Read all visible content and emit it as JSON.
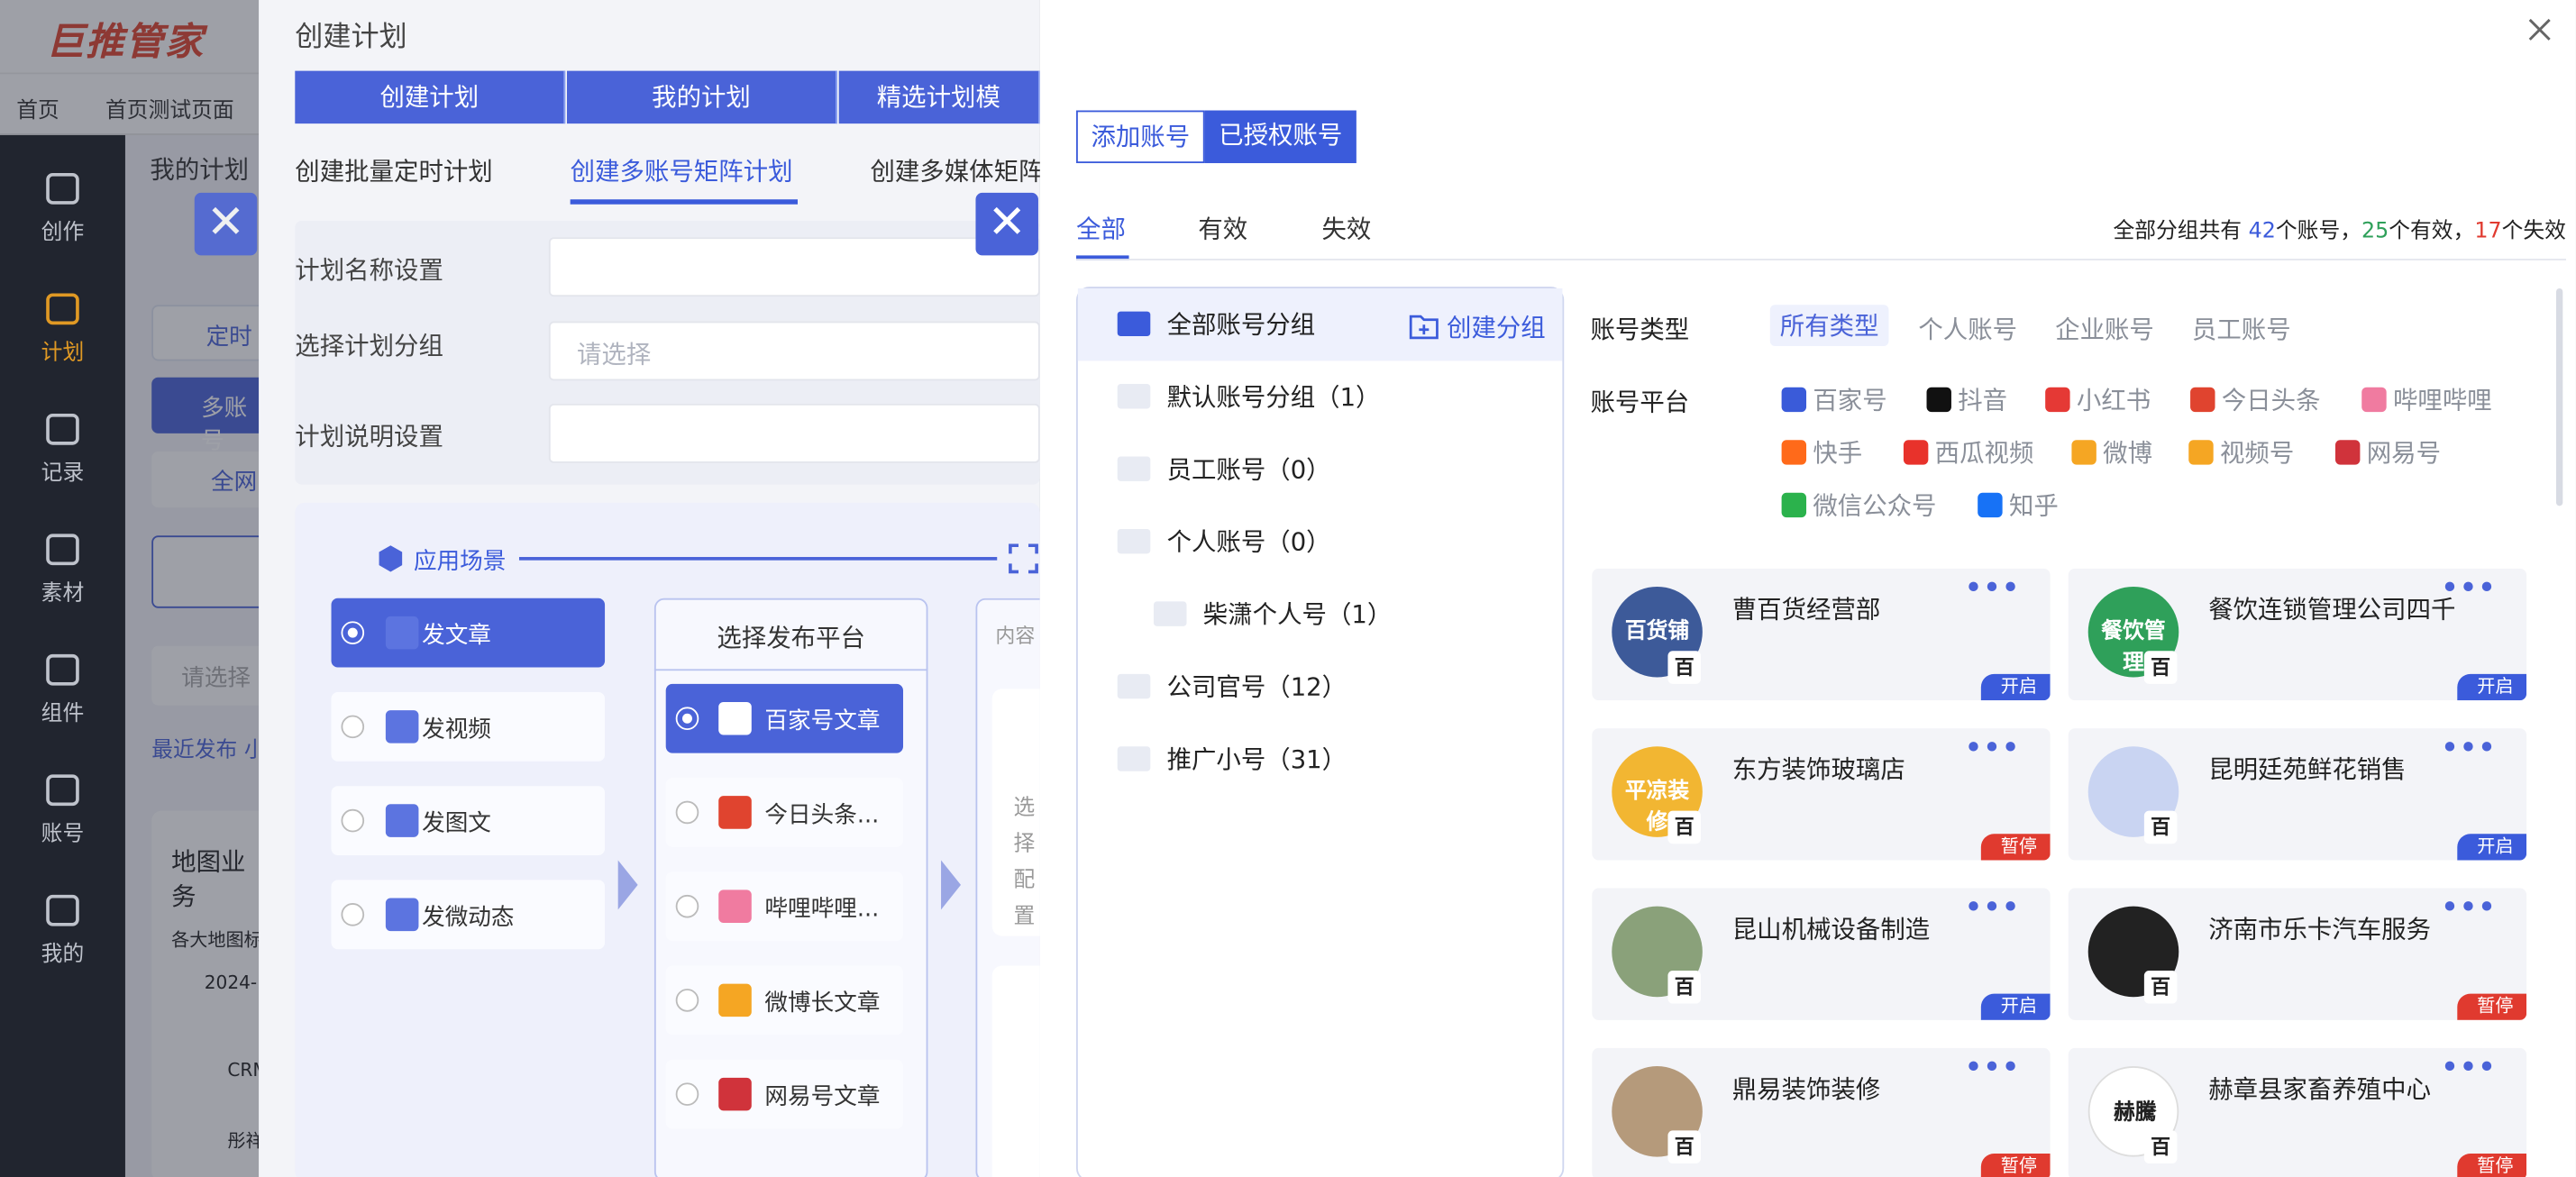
{
  "app": {
    "logo_text": "巨推管家"
  },
  "nav_tabs": [
    "首页",
    "首页测试页面"
  ],
  "sidebar": [
    {
      "label": "创作",
      "icon": "pen-icon"
    },
    {
      "label": "计划",
      "icon": "calendar-icon",
      "active": true
    },
    {
      "label": "记录",
      "icon": "clipboard-icon"
    },
    {
      "label": "素材",
      "icon": "cloud-upload-icon"
    },
    {
      "label": "组件",
      "icon": "puzzle-icon"
    },
    {
      "label": "账号",
      "icon": "users-icon"
    },
    {
      "label": "我的",
      "icon": "user-circle-icon"
    }
  ],
  "background": {
    "my_plan": "我的计划",
    "timed": "定时",
    "multi_account": "多账号",
    "whole_net": "全网",
    "please_select": "请选择",
    "recent_publish": "最近发布 小",
    "card_title": "地图业务",
    "card_sub": "各大地图标",
    "card_date": "2024-",
    "crm": "CRM",
    "shape": "彤祥"
  },
  "dialog": {
    "title": "创建计划",
    "top_tabs": [
      "创建计划",
      "我的计划",
      "精选计划模"
    ],
    "sub_tabs": [
      "创建批量定时计划",
      "创建多账号矩阵计划",
      "创建多媒体矩阵"
    ],
    "form": {
      "name_label": "计划名称设置",
      "group_label": "选择计划分组",
      "group_placeholder": "请选择",
      "desc_label": "计划说明设置"
    },
    "scene_label": "应用场景",
    "scene_options": [
      "发文章",
      "发视频",
      "发图文",
      "发微动态"
    ],
    "platform_title": "选择发布平台",
    "platforms": [
      {
        "label": "百家号文章",
        "color": "#ffffff"
      },
      {
        "label": "今日头条...",
        "color": "#e0442f"
      },
      {
        "label": "哔哩哔哩...",
        "color": "#f07ba0"
      },
      {
        "label": "微博长文章",
        "color": "#f5a623"
      },
      {
        "label": "网易号文章",
        "color": "#d0333b"
      }
    ],
    "content_tag": "内容",
    "content_hint": [
      "选",
      "择",
      "配",
      "置"
    ]
  },
  "drawer": {
    "seg_add": "添加账号",
    "seg_authorized": "已授权账号",
    "filter_tabs": [
      "全部",
      "有效",
      "失效"
    ],
    "summary": {
      "prefix": "全部分组共有 ",
      "total": "42",
      "mid1": "个账号，",
      "valid": "25",
      "mid2": "个有效，",
      "invalid": "17",
      "suffix": "个失效"
    },
    "groups": [
      {
        "label": "全部账号分组",
        "active": true,
        "indent": 0
      },
      {
        "label": "默认账号分组（1）",
        "indent": 0
      },
      {
        "label": "员工账号（0）",
        "indent": 0
      },
      {
        "label": "个人账号（0）",
        "indent": 0
      },
      {
        "label": "柴潇个人号（1）",
        "indent": 1
      },
      {
        "label": "公司官号（12）",
        "indent": 0
      },
      {
        "label": "推广小号（31）",
        "indent": 0
      }
    ],
    "create_group": "创建分组",
    "type_label": "账号类型",
    "types": [
      "所有类型",
      "个人账号",
      "企业账号",
      "员工账号"
    ],
    "platform_label": "账号平台",
    "platforms": [
      {
        "label": "百家号",
        "color": "#3a5bd9"
      },
      {
        "label": "抖音",
        "color": "#111111"
      },
      {
        "label": "小红书",
        "color": "#e53935"
      },
      {
        "label": "今日头条",
        "color": "#e0442f"
      },
      {
        "label": "哔哩哔哩",
        "color": "#f07ba0"
      },
      {
        "label": "快手",
        "color": "#ff6a1a"
      },
      {
        "label": "西瓜视频",
        "color": "#e8322b"
      },
      {
        "label": "微博",
        "color": "#f5a623"
      },
      {
        "label": "视频号",
        "color": "#f5a623"
      },
      {
        "label": "网易号",
        "color": "#d0333b"
      },
      {
        "label": "微信公众号",
        "color": "#2bb24c"
      },
      {
        "label": "知乎",
        "color": "#1772f6"
      }
    ],
    "accounts": [
      {
        "name": "曹百货经营部",
        "status": "开启",
        "on": true,
        "avatar_text": "百货铺",
        "avatar_color": "#3d5a99"
      },
      {
        "name": "餐饮连锁管理公司四千",
        "status": "开启",
        "on": true,
        "avatar_text": "餐饮管理",
        "avatar_color": "#2fa05a"
      },
      {
        "name": "东方装饰玻璃店",
        "status": "暂停",
        "on": false,
        "avatar_text": "平凉装修",
        "avatar_color": "#f2b632"
      },
      {
        "name": "昆明廷苑鲜花销售",
        "status": "开启",
        "on": true,
        "avatar_text": "",
        "avatar_color": "#c9d4f2"
      },
      {
        "name": "昆山机械设备制造",
        "status": "开启",
        "on": true,
        "avatar_text": "",
        "avatar_color": "#8aa17a"
      },
      {
        "name": "济南市乐卡汽车服务",
        "status": "暂停",
        "on": false,
        "avatar_text": "",
        "avatar_color": "#222222"
      },
      {
        "name": "鼎易装饰装修",
        "status": "暂停",
        "on": false,
        "avatar_text": "",
        "avatar_color": "#b59a7b"
      },
      {
        "name": "赫章县家畜养殖中心",
        "status": "暂停",
        "on": false,
        "avatar_text": "赫騰",
        "avatar_color": "#ffffff"
      }
    ],
    "badge_char": "百"
  }
}
